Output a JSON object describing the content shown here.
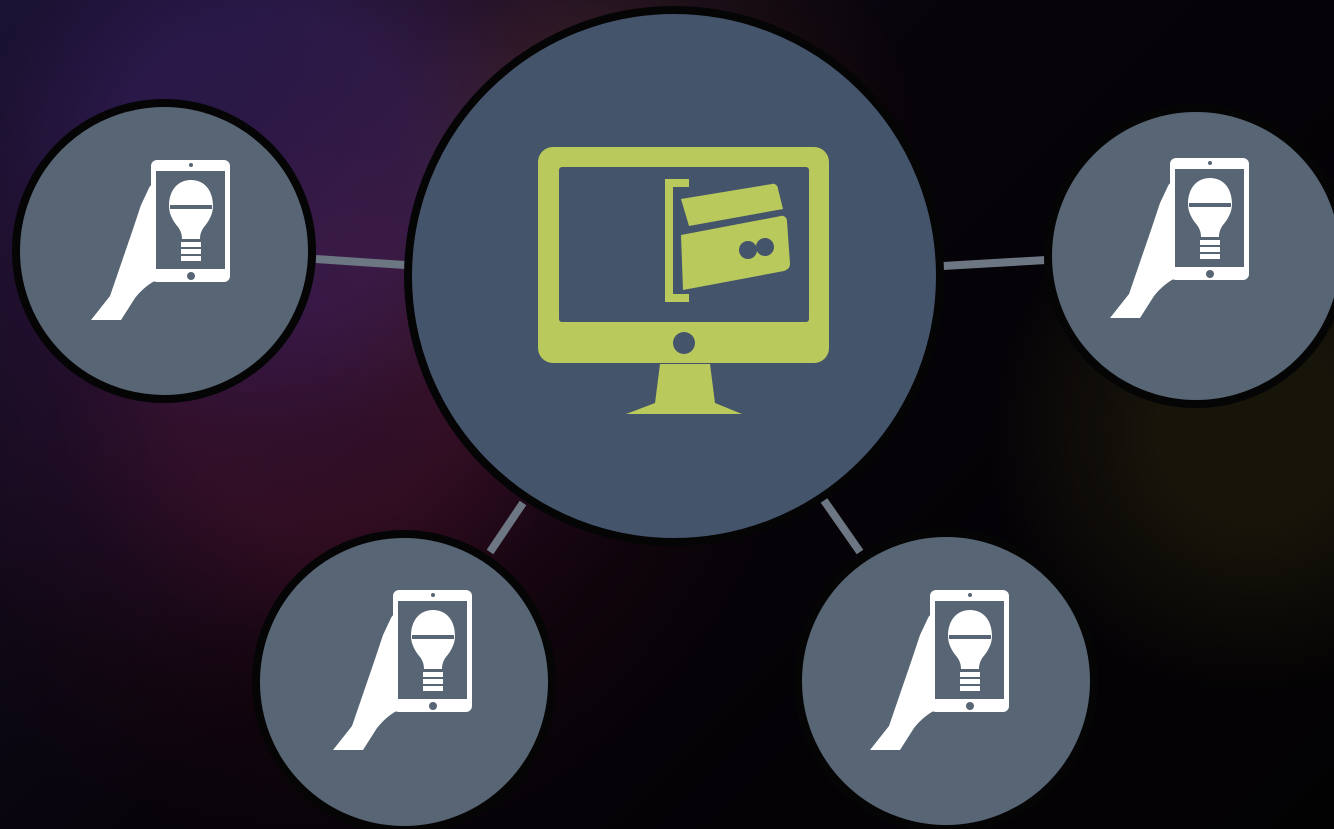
{
  "diagram": {
    "hub": {
      "icon": "monitor-credit-card-icon",
      "icon_color": "#b9c95b",
      "circle_color": "#44546b"
    },
    "devices": [
      {
        "id": "device-left",
        "icon": "hand-tablet-lightbulb-icon"
      },
      {
        "id": "device-right",
        "icon": "hand-tablet-lightbulb-icon"
      },
      {
        "id": "device-bottom-left",
        "icon": "hand-tablet-lightbulb-icon"
      },
      {
        "id": "device-bottom-right",
        "icon": "hand-tablet-lightbulb-icon"
      }
    ],
    "device_circle_color": "#576574",
    "connector_color": "#6d7783",
    "icon_foreground": "#ffffff"
  }
}
